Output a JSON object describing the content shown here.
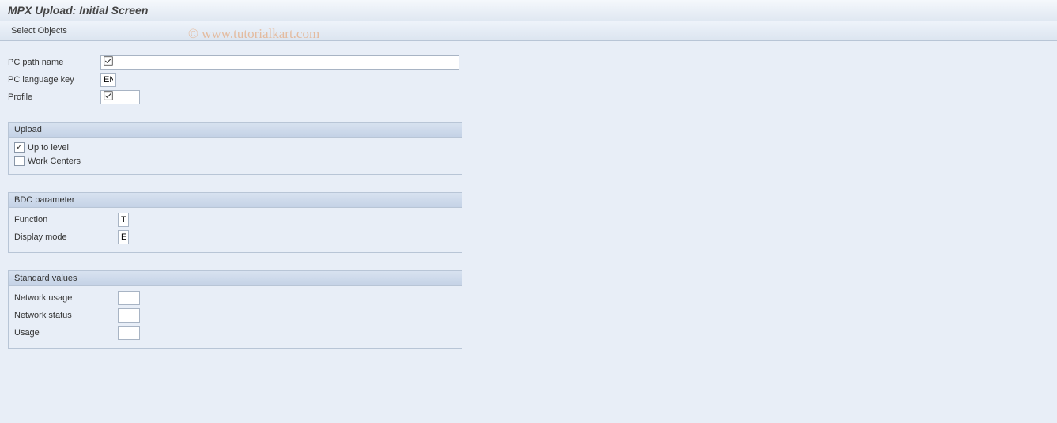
{
  "header": {
    "title": "MPX Upload: Initial Screen"
  },
  "toolbar": {
    "select_objects": "Select Objects"
  },
  "fields": {
    "pc_path_name_label": "PC path name",
    "pc_path_name_value": "",
    "pc_language_key_label": "PC language key",
    "pc_language_key_value": "EN",
    "profile_label": "Profile",
    "profile_value": ""
  },
  "upload_group": {
    "title": "Upload",
    "up_to_level_label": "Up to level",
    "up_to_level_checked": true,
    "work_centers_label": "Work Centers",
    "work_centers_checked": false
  },
  "bdc_group": {
    "title": "BDC parameter",
    "function_label": "Function",
    "function_value": "T",
    "display_mode_label": "Display mode",
    "display_mode_value": "E"
  },
  "standard_values_group": {
    "title": "Standard values",
    "network_usage_label": "Network usage",
    "network_usage_value": "",
    "network_status_label": "Network status",
    "network_status_value": "",
    "usage_label": "Usage",
    "usage_value": ""
  },
  "watermark": "© www.tutorialkart.com"
}
